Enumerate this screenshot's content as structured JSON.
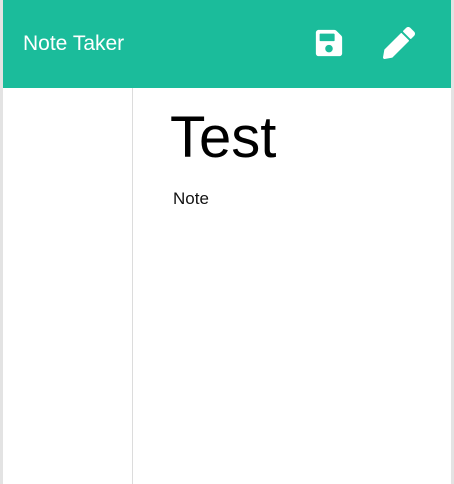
{
  "app": {
    "title": "Note Taker"
  },
  "toolbar": {
    "save_icon": "floppy-disk-icon",
    "new_icon": "pencil-icon"
  },
  "note": {
    "title": "Test",
    "text": "Note"
  },
  "colors": {
    "accent": "#1bbc9b",
    "icon": "#ffffff",
    "text": "#000000"
  }
}
